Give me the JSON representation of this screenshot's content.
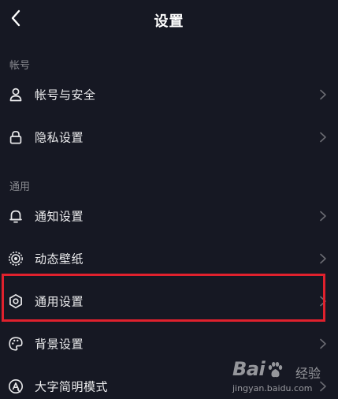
{
  "header": {
    "title": "设置"
  },
  "sections": [
    {
      "label": "帐号",
      "items": [
        {
          "label": "帐号与安全",
          "icon": "user-icon"
        },
        {
          "label": "隐私设置",
          "icon": "lock-icon"
        }
      ]
    },
    {
      "label": "通用",
      "items": [
        {
          "label": "通知设置",
          "icon": "bell-icon"
        },
        {
          "label": "动态壁纸",
          "icon": "live-wallpaper-icon"
        },
        {
          "label": "通用设置",
          "icon": "gear-icon"
        },
        {
          "label": "背景设置",
          "icon": "palette-icon"
        },
        {
          "label": "大字简明模式",
          "icon": "large-text-icon"
        }
      ]
    }
  ],
  "highlight": {
    "target": "通用设置",
    "color": "#e0212d"
  },
  "watermark": {
    "brand": "Bai",
    "brand_suffix": "经验",
    "url": "jingyan.baidu.com"
  },
  "colors": {
    "background": "#161823",
    "text": "#ececee",
    "muted": "#8a8b91"
  }
}
